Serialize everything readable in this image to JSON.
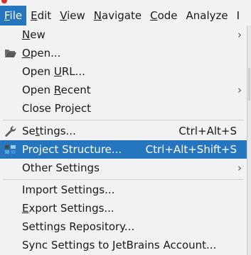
{
  "menubar": {
    "items": [
      {
        "label": "File",
        "mnemonic": "F",
        "rest": "ile",
        "active": true
      },
      {
        "label": "Edit",
        "mnemonic": "E",
        "rest": "dit"
      },
      {
        "label": "View",
        "mnemonic": "V",
        "rest": "iew"
      },
      {
        "label": "Navigate",
        "mnemonic": "N",
        "rest": "avigate"
      },
      {
        "label": "Code",
        "mnemonic": "C",
        "rest": "ode"
      },
      {
        "label": "Analyze",
        "mnemonic": "",
        "rest": "Analyze"
      },
      {
        "label": "I",
        "mnemonic": "",
        "rest": "I"
      }
    ]
  },
  "file_menu": {
    "items": [
      {
        "pre": "",
        "mn": "N",
        "post": "ew",
        "shortcut": "",
        "submenu": true
      },
      {
        "pre": "",
        "mn": "O",
        "post": "pen...",
        "shortcut": "",
        "icon": "folder-open-icon"
      },
      {
        "pre": "Open ",
        "mn": "U",
        "post": "RL...",
        "shortcut": ""
      },
      {
        "pre": "Open ",
        "mn": "R",
        "post": "ecent",
        "shortcut": "",
        "submenu": true
      },
      {
        "pre": "Close Pro",
        "mn": "j",
        "post": "ect",
        "shortcut": ""
      },
      {
        "pre": "Se",
        "mn": "t",
        "post": "tings...",
        "shortcut": "Ctrl+Alt+S",
        "icon": "wrench-icon"
      },
      {
        "pre": "Project Struct",
        "mn": "u",
        "post": "re...",
        "shortcut": "Ctrl+Alt+Shift+S",
        "icon": "project-structure-icon",
        "selected": true
      },
      {
        "pre": "Other Settings",
        "mn": "",
        "post": "",
        "shortcut": "",
        "submenu": true
      },
      {
        "pre": "",
        "mn": "I",
        "post": "mport Settings...",
        "shortcut": ""
      },
      {
        "pre": "",
        "mn": "E",
        "post": "xport Settings...",
        "shortcut": ""
      },
      {
        "pre": "Settings Repository...",
        "mn": "",
        "post": "",
        "shortcut": ""
      },
      {
        "pre": "Sync Settings to JetBrains Account...",
        "mn": "",
        "post": "",
        "shortcut": ""
      }
    ],
    "submenu_arrow": "›"
  }
}
